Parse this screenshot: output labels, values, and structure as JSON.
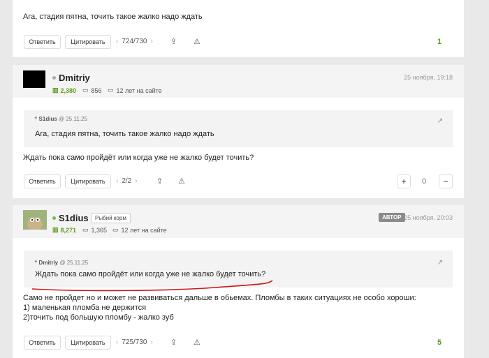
{
  "colors": {
    "accent_green": "#5d9b1f",
    "underline_red": "#d01515"
  },
  "comment1": {
    "text": "Ага, стадия пятна, точить такое жалко надо ждать",
    "reply_label": "Ответить",
    "quote_label": "Цитировать",
    "pager": "724/730",
    "count": "1"
  },
  "comment2": {
    "username": "Dmitriy",
    "rating": "2,380",
    "comments_count": "856",
    "tenure": "12 лет на сайте",
    "date": "25 ноября, 19:18",
    "quote": {
      "author": "S1dius",
      "date": "@ 25.11.25",
      "text": "Ага, стадия пятна, точить такое жалко надо ждать"
    },
    "text": "Ждать пока само пройдёт или когда уже не жалко будет точить?",
    "reply_label": "Ответить",
    "quote_label": "Цитировать",
    "pager": "2/2",
    "vote_plus": "+",
    "vote_count": "0",
    "vote_minus": "−"
  },
  "comment3": {
    "username": "S1dius",
    "tag": "Рыбий корм",
    "author_badge": "АВТОР",
    "rating": "8,271",
    "comments_count": "1,365",
    "tenure": "12 лет на сайте",
    "date": "25 ноября, 20:03",
    "quote": {
      "author": "Dmitriy",
      "date": "@ 25.11.25",
      "text": "Ждать пока само пройдёт или когда уже не жалко будет точить?"
    },
    "lines": [
      "Само не пройдет но и может не развиваться дальше в обьемах. Пломбы в таких ситуациях не особо хороши:",
      "1) маленькая пломба не держится",
      "2)точить под большую пломбу - жалко зуб"
    ],
    "reply_label": "Ответить",
    "quote_label": "Цитировать",
    "pager": "725/730",
    "count": "5"
  }
}
